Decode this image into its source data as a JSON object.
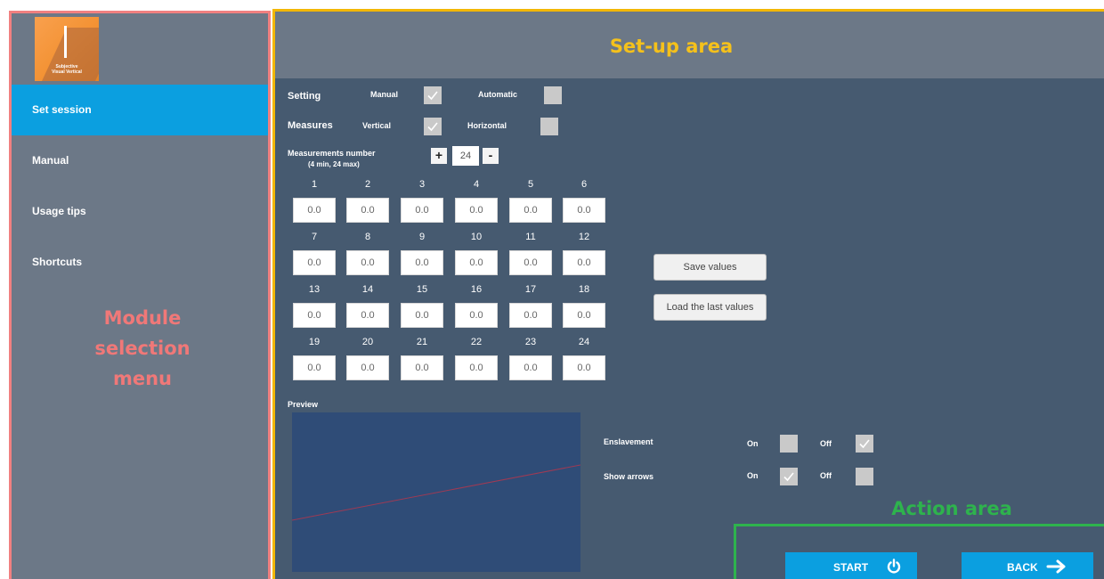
{
  "sidebar": {
    "logo": {
      "line1": "Subjective",
      "line2": "Visual Vertical"
    },
    "items": [
      {
        "label": "Set session",
        "active": true
      },
      {
        "label": "Manual"
      },
      {
        "label": "Usage tips"
      },
      {
        "label": "Shortcuts"
      }
    ]
  },
  "annotations": {
    "module_menu": [
      "Module",
      "selection",
      "menu"
    ],
    "setup_area": "Set-up area",
    "action_area": "Action area"
  },
  "setting": {
    "label": "Setting",
    "manual": {
      "label": "Manual",
      "checked": true
    },
    "automatic": {
      "label": "Automatic",
      "checked": false
    }
  },
  "measures": {
    "label": "Measures",
    "vertical": {
      "label": "Vertical",
      "checked": true
    },
    "horizontal": {
      "label": "Horizontal",
      "checked": false
    }
  },
  "measurements": {
    "label": "Measurements number",
    "sublabel": "(4 min, 24 max)",
    "plus": "+",
    "minus": "-",
    "count": "24"
  },
  "values": [
    {
      "n": "1",
      "v": "0.0"
    },
    {
      "n": "2",
      "v": "0.0"
    },
    {
      "n": "3",
      "v": "0.0"
    },
    {
      "n": "4",
      "v": "0.0"
    },
    {
      "n": "5",
      "v": "0.0"
    },
    {
      "n": "6",
      "v": "0.0"
    },
    {
      "n": "7",
      "v": "0.0"
    },
    {
      "n": "8",
      "v": "0.0"
    },
    {
      "n": "9",
      "v": "0.0"
    },
    {
      "n": "10",
      "v": "0.0"
    },
    {
      "n": "11",
      "v": "0.0"
    },
    {
      "n": "12",
      "v": "0.0"
    },
    {
      "n": "13",
      "v": "0.0"
    },
    {
      "n": "14",
      "v": "0.0"
    },
    {
      "n": "15",
      "v": "0.0"
    },
    {
      "n": "16",
      "v": "0.0"
    },
    {
      "n": "17",
      "v": "0.0"
    },
    {
      "n": "18",
      "v": "0.0"
    },
    {
      "n": "19",
      "v": "0.0"
    },
    {
      "n": "20",
      "v": "0.0"
    },
    {
      "n": "21",
      "v": "0.0"
    },
    {
      "n": "22",
      "v": "0.0"
    },
    {
      "n": "23",
      "v": "0.0"
    },
    {
      "n": "24",
      "v": "0.0"
    }
  ],
  "buttons": {
    "save": "Save values",
    "load": "Load the last values"
  },
  "preview": {
    "label": "Preview"
  },
  "enslavement": {
    "label": "Enslavement",
    "on": {
      "label": "On",
      "checked": false
    },
    "off": {
      "label": "Off",
      "checked": true
    }
  },
  "show_arrows": {
    "label": "Show arrows",
    "on": {
      "label": "On",
      "checked": true
    },
    "off": {
      "label": "Off",
      "checked": false
    }
  },
  "actions": {
    "start": "START",
    "back": "BACK"
  },
  "colors": {
    "accent": "#0b9fe0",
    "panel": "#465a70",
    "sidebar": "#6c7887",
    "module_annotation": "#f07878",
    "setup_annotation": "#f5c11b",
    "action_annotation": "#2eb34d",
    "logo": "#f39233"
  },
  "icons": {
    "check": "checkmark-icon",
    "power": "power-icon",
    "back": "arrow-right-icon"
  }
}
